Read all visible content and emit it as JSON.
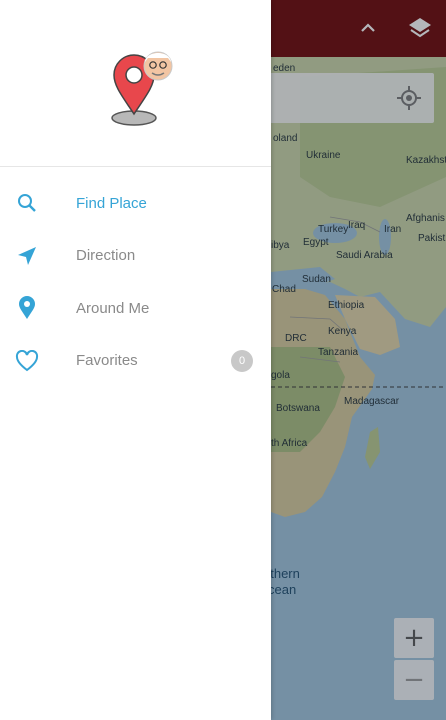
{
  "colors": {
    "accent": "#35a4d6",
    "map_topbar": "#6b0000",
    "badge": "#c8c8c8",
    "pin": "#e8474c"
  },
  "map": {
    "top_icons": [
      "chevron-up-icon",
      "layers-icon"
    ],
    "labels": [
      {
        "text": "eden",
        "cls": ""
      },
      {
        "text": "oland",
        "cls": ""
      },
      {
        "text": "Ukraine",
        "cls": ""
      },
      {
        "text": "Kazakhst",
        "cls": ""
      },
      {
        "text": "Turkey",
        "cls": ""
      },
      {
        "text": "Iraq",
        "cls": ""
      },
      {
        "text": "Iran",
        "cls": ""
      },
      {
        "text": "Afghanis",
        "cls": ""
      },
      {
        "text": "Pakist",
        "cls": ""
      },
      {
        "text": "ibya",
        "cls": ""
      },
      {
        "text": "Egypt",
        "cls": ""
      },
      {
        "text": "Saudi Arabia",
        "cls": ""
      },
      {
        "text": "Sudan",
        "cls": ""
      },
      {
        "text": "Chad",
        "cls": ""
      },
      {
        "text": "Ethiopia",
        "cls": ""
      },
      {
        "text": "DRC",
        "cls": ""
      },
      {
        "text": "Kenya",
        "cls": ""
      },
      {
        "text": "Tanzania",
        "cls": ""
      },
      {
        "text": "gola",
        "cls": ""
      },
      {
        "text": "Madagascar",
        "cls": ""
      },
      {
        "text": "Botswana",
        "cls": ""
      },
      {
        "text": "th Africa",
        "cls": ""
      },
      {
        "text": "uthern",
        "cls": "ocean"
      },
      {
        "text": "cean",
        "cls": "ocean"
      }
    ],
    "zoom_in_label": "+",
    "zoom_out_label": "−"
  },
  "drawer": {
    "logo_icon": "map-pin-with-avatar-icon",
    "menu": [
      {
        "label": "Find Place",
        "icon": "search-icon",
        "active": true
      },
      {
        "label": "Direction",
        "icon": "navigation-arrow-icon",
        "active": false
      },
      {
        "label": "Around Me",
        "icon": "location-pin-icon",
        "active": false
      },
      {
        "label": "Favorites",
        "icon": "heart-icon",
        "active": false,
        "badge": "0"
      }
    ]
  }
}
